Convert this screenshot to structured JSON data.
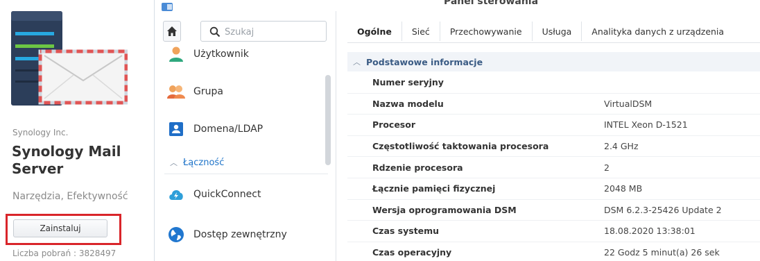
{
  "package": {
    "vendor": "Synology Inc.",
    "name": "Synology Mail Server",
    "categories": "Narzędzia, Efektywność",
    "install_label": "Zainstaluj",
    "downloads": "Liczba pobrań : 3828497",
    "highlight_color": "#d9252a"
  },
  "window": {
    "title": "Panel sterowania"
  },
  "sidebar": {
    "search_placeholder": "Szukaj",
    "items": [
      {
        "label": "Użytkownik",
        "icon": "user-icon"
      },
      {
        "label": "Grupa",
        "icon": "group-icon"
      },
      {
        "label": "Domena/LDAP",
        "icon": "domain-icon"
      }
    ],
    "group_label": "Łączność",
    "group_items": [
      {
        "label": "QuickConnect",
        "icon": "quickconnect-icon"
      },
      {
        "label": "Dostęp zewnętrzny",
        "icon": "globe-icon"
      }
    ]
  },
  "main": {
    "tabs": [
      "Ogólne",
      "Sieć",
      "Przechowywanie",
      "Usługa",
      "Analityka danych z urządzenia"
    ],
    "active_tab": "Ogólne",
    "section_title": "Podstawowe informacje",
    "rows": [
      {
        "key": "Numer seryjny",
        "value": ""
      },
      {
        "key": "Nazwa modelu",
        "value": "VirtualDSM"
      },
      {
        "key": "Procesor",
        "value": "INTEL Xeon D-1521"
      },
      {
        "key": "Częstotliwość taktowania procesora",
        "value": "2.4 GHz"
      },
      {
        "key": "Rdzenie procesora",
        "value": "2"
      },
      {
        "key": "Łącznie pamięci fizycznej",
        "value": "2048 MB"
      },
      {
        "key": "Wersja oprogramowania DSM",
        "value": "DSM 6.2.3-25426 Update 2"
      },
      {
        "key": "Czas systemu",
        "value": "18.08.2020 13:38:01"
      },
      {
        "key": "Czas operacyjny",
        "value": "22 Godz 5 minut(a) 26 sek"
      }
    ]
  }
}
